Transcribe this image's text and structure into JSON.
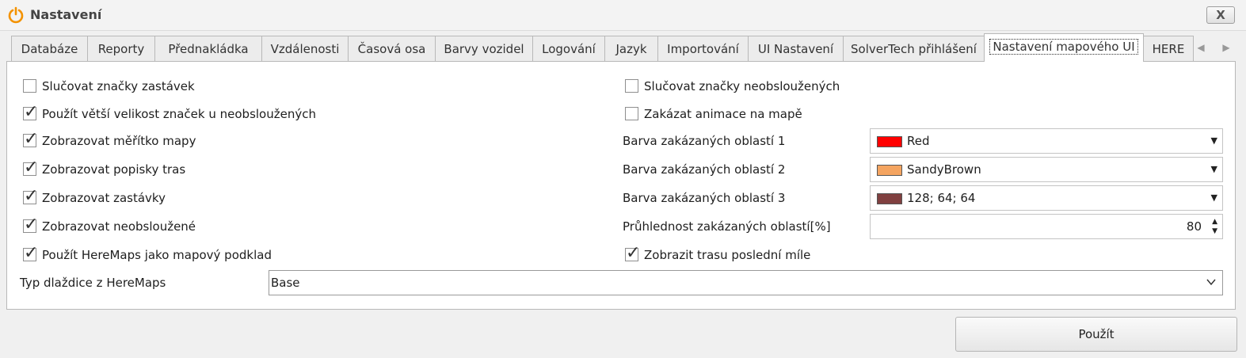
{
  "window": {
    "title": "Nastavení",
    "close_label": "X"
  },
  "tabs": [
    {
      "label": "Databáze"
    },
    {
      "label": "Reporty"
    },
    {
      "label": "Přednakládka"
    },
    {
      "label": "Vzdálenosti"
    },
    {
      "label": "Časová osa"
    },
    {
      "label": "Barvy vozidel"
    },
    {
      "label": "Logování"
    },
    {
      "label": "Jazyk"
    },
    {
      "label": "Importování"
    },
    {
      "label": "UI Nastavení"
    },
    {
      "label": "SolverTech přihlášení"
    },
    {
      "label": "Nastavení mapového UI",
      "active": true
    },
    {
      "label": "HERE"
    }
  ],
  "left_checks": [
    {
      "label": "Slučovat značky zastávek",
      "checked": false
    },
    {
      "label": "Použít větší velikost značek u neobsloužených",
      "checked": true
    },
    {
      "label": "Zobrazovat měřítko mapy",
      "checked": true
    },
    {
      "label": "Zobrazovat popisky tras",
      "checked": true
    },
    {
      "label": "Zobrazovat zastávky",
      "checked": true
    },
    {
      "label": "Zobrazovat neobsloužené",
      "checked": true
    },
    {
      "label": "Použít HereMaps jako mapový podklad",
      "checked": true
    }
  ],
  "right_checks": [
    {
      "label": "Slučovat značky neobsloužených",
      "checked": false
    },
    {
      "label": "Zakázat animace na mapě",
      "checked": false
    },
    {
      "label": "Zobrazit trasu poslední míle",
      "checked": true
    }
  ],
  "color_fields": [
    {
      "label": "Barva zakázaných oblastí 1",
      "value": "Red",
      "color": "#ff0000"
    },
    {
      "label": "Barva zakázaných oblastí 2",
      "value": "SandyBrown",
      "color": "#f4a460"
    },
    {
      "label": "Barva zakázaných oblastí 3",
      "value": "128; 64; 64",
      "color": "#804040"
    }
  ],
  "opacity": {
    "label": "Průhlednost zakázaných oblastí[%]",
    "value": "80"
  },
  "tile_type": {
    "label": "Typ dlaždice z HereMaps",
    "value": "Base"
  },
  "apply_label": "Použít",
  "icons": {
    "app": "power-icon",
    "close": "close-icon",
    "tab_prev": "arrow-left-icon",
    "tab_next": "arrow-right-icon",
    "dropdown": "triangle-down-icon",
    "chevron": "chevron-down-icon"
  }
}
